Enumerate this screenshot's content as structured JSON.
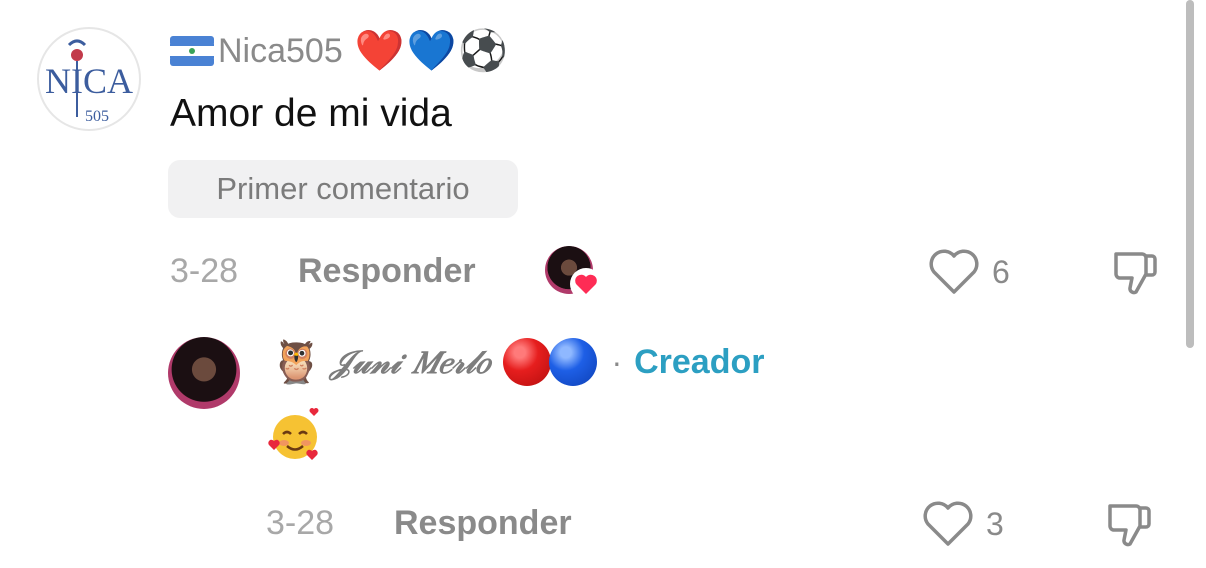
{
  "comment": {
    "username": "Nica505",
    "flag_icon": "nicaragua-flag",
    "name_emojis": [
      "❤️",
      "💙",
      "⚽"
    ],
    "text": "Amor de mi vida",
    "badge": "Primer comentario",
    "date": "3-28",
    "reply_label": "Responder",
    "like_count": "6",
    "liked_by_creator": true
  },
  "reply": {
    "name_emoji": "🦉",
    "username": "𝒥𝓊𝓃𝒾 𝑀𝑒𝓇𝓁𝑜",
    "name_dots": [
      "red-circle",
      "blue-circle"
    ],
    "separator": "·",
    "creator_label": "Creador",
    "text_emoji": "🥰",
    "date": "3-28",
    "reply_label": "Responder",
    "like_count": "3"
  },
  "colors": {
    "creator": "#2c9fc2",
    "muted": "#8a8a8a",
    "heart_badge": "#fe2c55",
    "pill_bg": "#f1f1f2"
  }
}
